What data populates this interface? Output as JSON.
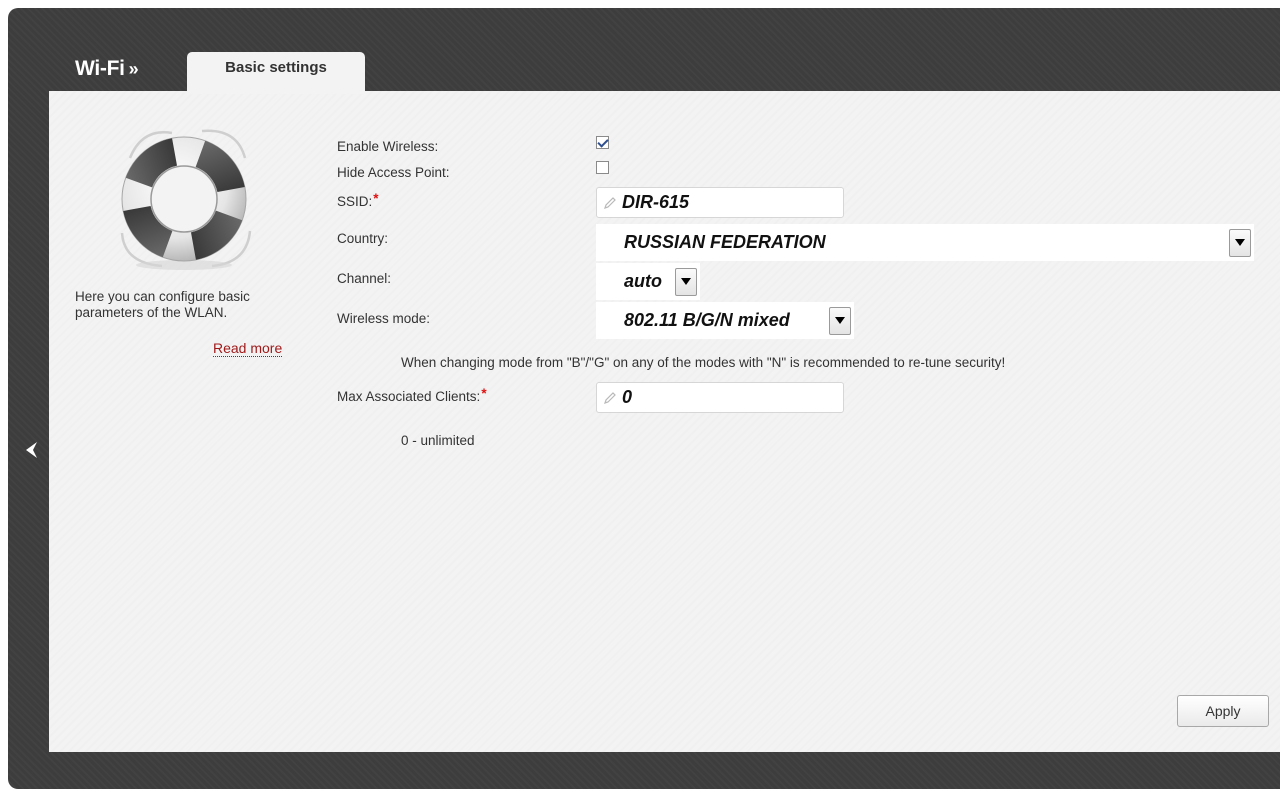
{
  "header": {
    "section_title": "Wi-Fi",
    "separator": "»",
    "tab_label": "Basic settings"
  },
  "sidebar": {
    "description": "Here you can configure basic parameters of the WLAN.",
    "read_more": "Read more",
    "illustration": "lifebuoy-icon"
  },
  "form": {
    "enable_wireless": {
      "label": "Enable Wireless:",
      "checked": true
    },
    "hide_access_point": {
      "label": "Hide Access Point:",
      "checked": false
    },
    "ssid": {
      "label": "SSID:",
      "required_mark": "*",
      "value": "DIR-615"
    },
    "country": {
      "label": "Country:",
      "value": "RUSSIAN FEDERATION"
    },
    "channel": {
      "label": "Channel:",
      "value": "auto"
    },
    "wireless_mode": {
      "label": "Wireless mode:",
      "value": "802.11 B/G/N mixed"
    },
    "mode_note": "When changing mode from \"B\"/\"G\" on any of the modes with \"N\" is recommended to re-tune security!",
    "max_clients": {
      "label": "Max Associated Clients:",
      "required_mark": "*",
      "value": "0"
    },
    "max_clients_hint": "0 - unlimited"
  },
  "actions": {
    "apply_label": "Apply"
  },
  "colors": {
    "frame_bg": "#3d3d3d",
    "panel_bg": "#f3f3f3",
    "required": "#dd1111",
    "link": "#a01a1a"
  }
}
